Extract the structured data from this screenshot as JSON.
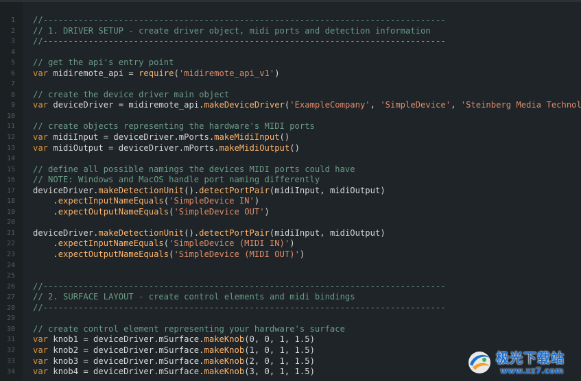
{
  "editor": {
    "lines": [
      {
        "n": "1",
        "tokens": [
          {
            "t": "//--------------------------------------------------------------------------------",
            "c": "comment"
          }
        ]
      },
      {
        "n": "2",
        "tokens": [
          {
            "t": "// 1. DRIVER SETUP - create driver object, midi ports and detection information",
            "c": "comment"
          }
        ]
      },
      {
        "n": "3",
        "tokens": [
          {
            "t": "//--------------------------------------------------------------------------------",
            "c": "comment"
          }
        ]
      },
      {
        "n": "4",
        "tokens": []
      },
      {
        "n": "5",
        "tokens": [
          {
            "t": "// get the api's entry point",
            "c": "comment"
          }
        ]
      },
      {
        "n": "6",
        "tokens": [
          {
            "t": "var",
            "c": "keyword"
          },
          {
            "t": " midiremote_api = ",
            "c": "text"
          },
          {
            "t": "require",
            "c": "func"
          },
          {
            "t": "(",
            "c": "text"
          },
          {
            "t": "'midiremote_api_v1'",
            "c": "string"
          },
          {
            "t": ")",
            "c": "text"
          }
        ]
      },
      {
        "n": "7",
        "tokens": []
      },
      {
        "n": "8",
        "tokens": [
          {
            "t": "// create the device driver main object",
            "c": "comment"
          }
        ]
      },
      {
        "n": "9",
        "tokens": [
          {
            "t": "var",
            "c": "keyword"
          },
          {
            "t": " deviceDriver = midiremote_api.",
            "c": "text"
          },
          {
            "t": "makeDeviceDriver",
            "c": "func"
          },
          {
            "t": "(",
            "c": "text"
          },
          {
            "t": "'ExampleCompany'",
            "c": "string"
          },
          {
            "t": ", ",
            "c": "text"
          },
          {
            "t": "'SimpleDevice'",
            "c": "string"
          },
          {
            "t": ", ",
            "c": "text"
          },
          {
            "t": "'Steinberg Media Technologies GmbH'",
            "c": "string"
          },
          {
            "t": ")",
            "c": "text"
          }
        ]
      },
      {
        "n": "10",
        "tokens": []
      },
      {
        "n": "11",
        "tokens": [
          {
            "t": "// create objects representing the hardware's MIDI ports",
            "c": "comment"
          }
        ]
      },
      {
        "n": "12",
        "tokens": [
          {
            "t": "var",
            "c": "keyword"
          },
          {
            "t": " midiInput = deviceDriver.mPorts.",
            "c": "text"
          },
          {
            "t": "makeMidiInput",
            "c": "func"
          },
          {
            "t": "()",
            "c": "text"
          }
        ]
      },
      {
        "n": "13",
        "tokens": [
          {
            "t": "var",
            "c": "keyword"
          },
          {
            "t": " midiOutput = deviceDriver.mPorts.",
            "c": "text"
          },
          {
            "t": "makeMidiOutput",
            "c": "func"
          },
          {
            "t": "()",
            "c": "text"
          }
        ]
      },
      {
        "n": "14",
        "tokens": []
      },
      {
        "n": "15",
        "tokens": [
          {
            "t": "// define all possible namings the devices MIDI ports could have",
            "c": "comment"
          }
        ]
      },
      {
        "n": "16",
        "tokens": [
          {
            "t": "// NOTE: Windows and MacOS handle port naming differently",
            "c": "comment"
          }
        ]
      },
      {
        "n": "17",
        "tokens": [
          {
            "t": "deviceDriver.",
            "c": "text"
          },
          {
            "t": "makeDetectionUnit",
            "c": "func"
          },
          {
            "t": "().",
            "c": "text"
          },
          {
            "t": "detectPortPair",
            "c": "func"
          },
          {
            "t": "(midiInput, midiOutput)",
            "c": "text"
          }
        ]
      },
      {
        "n": "18",
        "tokens": [
          {
            "t": "    .",
            "c": "text"
          },
          {
            "t": "expectInputNameEquals",
            "c": "func"
          },
          {
            "t": "(",
            "c": "text"
          },
          {
            "t": "'SimpleDevice IN'",
            "c": "string"
          },
          {
            "t": ")",
            "c": "text"
          }
        ]
      },
      {
        "n": "19",
        "tokens": [
          {
            "t": "    .",
            "c": "text"
          },
          {
            "t": "expectOutputNameEquals",
            "c": "func"
          },
          {
            "t": "(",
            "c": "text"
          },
          {
            "t": "'SimpleDevice OUT'",
            "c": "string"
          },
          {
            "t": ")",
            "c": "text"
          }
        ]
      },
      {
        "n": "20",
        "tokens": []
      },
      {
        "n": "21",
        "tokens": [
          {
            "t": "deviceDriver.",
            "c": "text"
          },
          {
            "t": "makeDetectionUnit",
            "c": "func"
          },
          {
            "t": "().",
            "c": "text"
          },
          {
            "t": "detectPortPair",
            "c": "func"
          },
          {
            "t": "(midiInput, midiOutput)",
            "c": "text"
          }
        ]
      },
      {
        "n": "22",
        "tokens": [
          {
            "t": "    .",
            "c": "text"
          },
          {
            "t": "expectInputNameEquals",
            "c": "func"
          },
          {
            "t": "(",
            "c": "text"
          },
          {
            "t": "'SimpleDevice (MIDI IN)'",
            "c": "string"
          },
          {
            "t": ")",
            "c": "text"
          }
        ]
      },
      {
        "n": "23",
        "tokens": [
          {
            "t": "    .",
            "c": "text"
          },
          {
            "t": "expectOutputNameEquals",
            "c": "func"
          },
          {
            "t": "(",
            "c": "text"
          },
          {
            "t": "'SimpleDevice (MIDI OUT)'",
            "c": "string"
          },
          {
            "t": ")",
            "c": "text"
          }
        ]
      },
      {
        "n": "24",
        "tokens": []
      },
      {
        "n": "25",
        "tokens": []
      },
      {
        "n": "26",
        "tokens": [
          {
            "t": "//--------------------------------------------------------------------------------",
            "c": "comment"
          }
        ]
      },
      {
        "n": "27",
        "tokens": [
          {
            "t": "// 2. SURFACE LAYOUT - create control elements and midi bindings",
            "c": "comment"
          }
        ]
      },
      {
        "n": "28",
        "tokens": [
          {
            "t": "//--------------------------------------------------------------------------------",
            "c": "comment"
          }
        ]
      },
      {
        "n": "29",
        "tokens": []
      },
      {
        "n": "30",
        "tokens": [
          {
            "t": "// create control element representing your hardware's surface",
            "c": "comment"
          }
        ]
      },
      {
        "n": "31",
        "tokens": [
          {
            "t": "var",
            "c": "keyword"
          },
          {
            "t": " knob1 = deviceDriver.mSurface.",
            "c": "text"
          },
          {
            "t": "makeKnob",
            "c": "func"
          },
          {
            "t": "(0, 0, 1, 1.5)",
            "c": "text"
          }
        ]
      },
      {
        "n": "32",
        "tokens": [
          {
            "t": "var",
            "c": "keyword"
          },
          {
            "t": " knob2 = deviceDriver.mSurface.",
            "c": "text"
          },
          {
            "t": "makeKnob",
            "c": "func"
          },
          {
            "t": "(1, 0, 1, 1.5)",
            "c": "text"
          }
        ]
      },
      {
        "n": "33",
        "tokens": [
          {
            "t": "var",
            "c": "keyword"
          },
          {
            "t": " knob3 = deviceDriver.mSurface.",
            "c": "text"
          },
          {
            "t": "makeKnob",
            "c": "func"
          },
          {
            "t": "(2, 0, 1, 1.5)",
            "c": "text"
          }
        ]
      },
      {
        "n": "34",
        "tokens": [
          {
            "t": "var",
            "c": "keyword"
          },
          {
            "t": " knob4 = deviceDriver.mSurface.",
            "c": "text"
          },
          {
            "t": "makeKnob",
            "c": "func"
          },
          {
            "t": "(3, 0, 1, 1.5)",
            "c": "text"
          }
        ]
      }
    ]
  },
  "watermark": {
    "title": "极光下载站",
    "url": "www.xz7.com"
  },
  "colors": {
    "background": "#1e2427",
    "comment": "#6a9c86",
    "keyword": "#e0943a",
    "function": "#ffb36b",
    "string": "#e08c6b",
    "text": "#d7d7d7",
    "line_number": "#4f5b62",
    "watermark": "#1d6fd1"
  }
}
